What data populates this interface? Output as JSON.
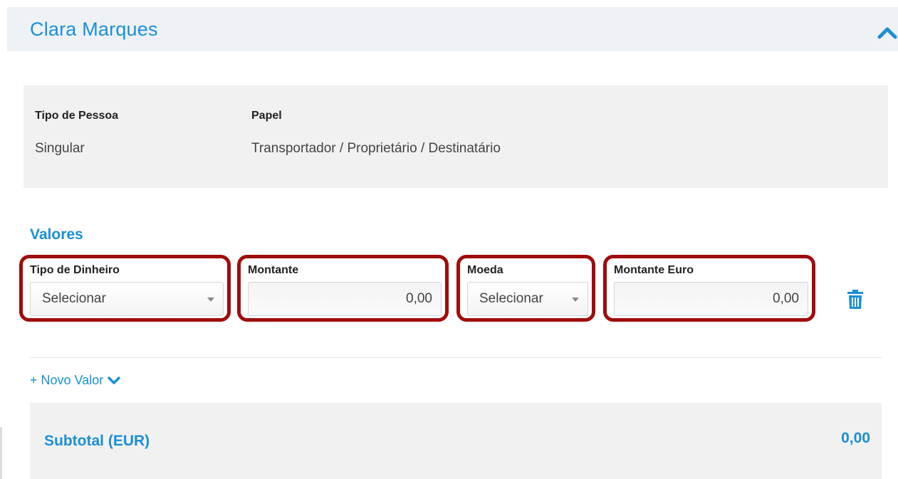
{
  "header": {
    "title": "Clara Marques",
    "collapse_icon": "chevron-up-icon"
  },
  "person": {
    "type_label": "Tipo de Pessoa",
    "type_value": "Singular",
    "role_label": "Papel",
    "role_value": "Transportador / Proprietário / Destinatário"
  },
  "values": {
    "section_title": "Valores",
    "fields": {
      "money_type": {
        "label": "Tipo de Dinheiro",
        "value": "Selecionar"
      },
      "amount": {
        "label": "Montante",
        "value": "0,00"
      },
      "currency": {
        "label": "Moeda",
        "value": "Selecionar"
      },
      "amount_euro": {
        "label": "Montante Euro",
        "value": "0,00"
      }
    },
    "delete_icon": "trash-icon",
    "new_value_label": "+ Novo Valor",
    "new_value_icon": "chevron-down-icon"
  },
  "subtotal": {
    "label": "Subtotal (EUR)",
    "value": "0,00"
  },
  "colors": {
    "accent": "#1b8fd6",
    "highlight_border": "#a00c0c",
    "panel": "#f1f1f1"
  }
}
